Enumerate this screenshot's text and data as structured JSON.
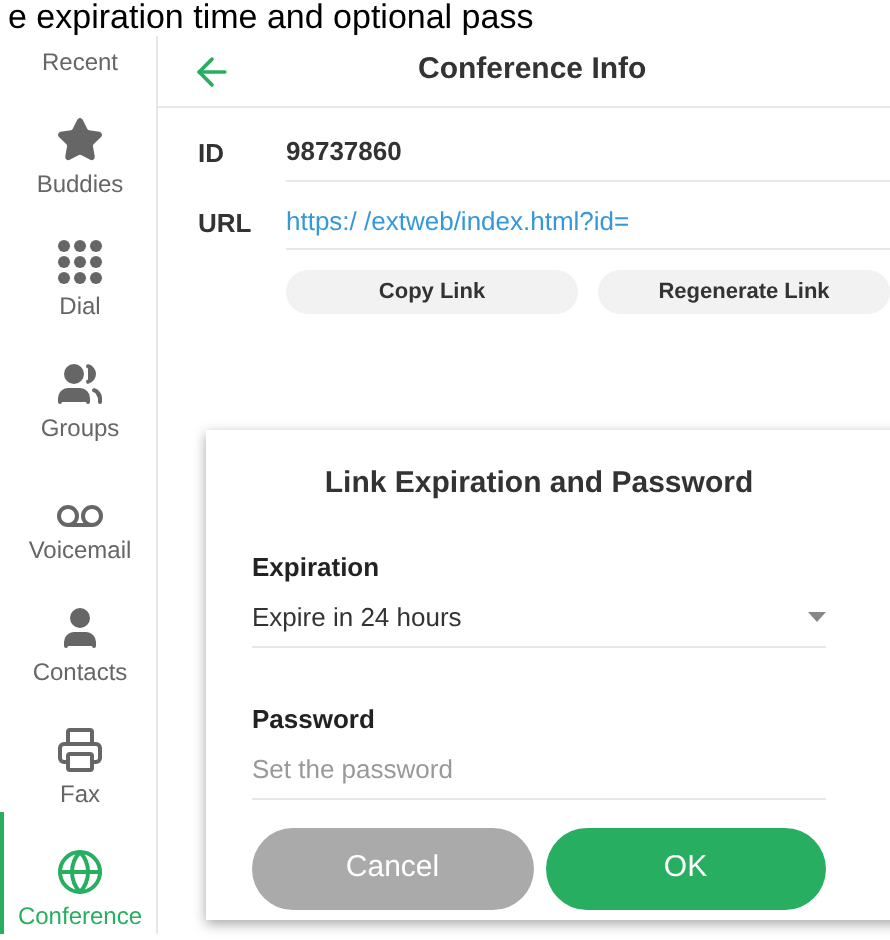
{
  "caption": "e expiration time and optional pass",
  "sidebar": {
    "items": [
      {
        "label": "Recent",
        "kind": "none",
        "selected": false
      },
      {
        "label": "Buddies",
        "kind": "star",
        "selected": false
      },
      {
        "label": "Dial",
        "kind": "dial",
        "selected": false
      },
      {
        "label": "Groups",
        "kind": "groups",
        "selected": false
      },
      {
        "label": "Voicemail",
        "kind": "voicemail",
        "selected": false
      },
      {
        "label": "Contacts",
        "kind": "contact",
        "selected": false
      },
      {
        "label": "Fax",
        "kind": "fax",
        "selected": false
      },
      {
        "label": "Conference",
        "kind": "globe",
        "selected": true
      }
    ]
  },
  "header": {
    "title": "Conference Info"
  },
  "fields": [
    {
      "label": "ID",
      "value": "98737860",
      "kind": "text"
    },
    {
      "label": "URL",
      "value": "https:/ /extweb/index.html?id=",
      "kind": "link"
    }
  ],
  "buttons": [
    "Copy Link",
    "Regenerate Link"
  ],
  "dialog": {
    "title": "Link Expiration and Password",
    "expiration": {
      "label": "Expiration",
      "value": "Expire in 24 hours"
    },
    "password": {
      "label": "Password",
      "placeholder": "Set the password"
    },
    "buttons": [
      {
        "label": "Cancel",
        "kind": "secondary"
      },
      {
        "label": "OK",
        "kind": "primary"
      }
    ]
  }
}
